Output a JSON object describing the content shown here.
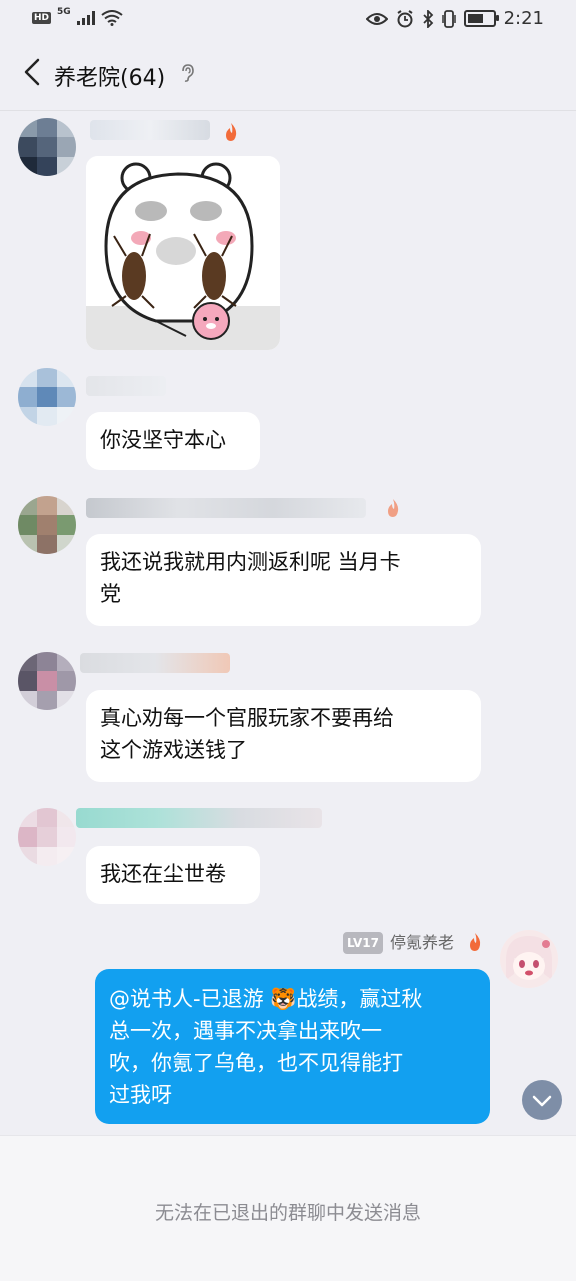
{
  "status_bar": {
    "hd_label": "HD",
    "network_label": "5G",
    "time": "2:21",
    "icons": [
      "signal-icon",
      "wifi-icon",
      "eye-icon",
      "alarm-icon",
      "bluetooth-icon",
      "vibrate-icon",
      "battery-icon"
    ],
    "battery_level": 0.65
  },
  "header": {
    "title": "养老院(64)",
    "back_icon": "chevron-left-icon",
    "mode_icon": "ear-icon"
  },
  "messages": [
    {
      "type": "sticker",
      "sender": "blurred",
      "content": "sticker-bear-holding-cockroaches"
    },
    {
      "type": "text",
      "sender": "blurred",
      "text": "你没坚守本心"
    },
    {
      "type": "text",
      "sender": "blurred",
      "text_line1": "我还说我就用内测返利呢  当月卡",
      "text_line2": "党"
    },
    {
      "type": "text",
      "sender": "blurred",
      "text_line1": "真心劝每一个官服玩家不要再给",
      "text_line2": "这个游戏送钱了"
    },
    {
      "type": "text",
      "sender": "blurred",
      "text": "我还在尘世卷"
    },
    {
      "type": "text",
      "sender": "me",
      "level": "LV17",
      "nickname": "停氪养老",
      "line1": "@说书人-已退游 🐯战绩，赢过秋",
      "line2": "总一次，遇事不决拿出来吹一",
      "line3": "吹，你氪了乌龟，也不见得能打",
      "line4": "过我呀"
    }
  ],
  "footer": {
    "notice": "无法在已退出的群聊中发送消息"
  },
  "colors": {
    "background": "#efeff4",
    "my_bubble": "#12a0f0",
    "other_bubble": "#ffffff",
    "flame": "#f26b3a"
  }
}
